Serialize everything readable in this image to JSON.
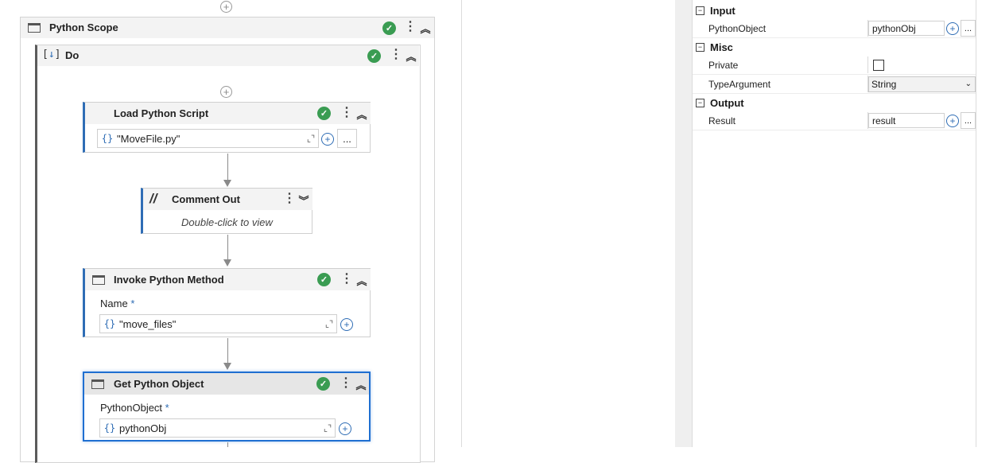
{
  "designer": {
    "python_scope": {
      "title": "Python Scope"
    },
    "do": {
      "title": "Do"
    },
    "load_script": {
      "title": "Load Python Script",
      "code": "\"MoveFile.py\"",
      "more": "..."
    },
    "comment_out": {
      "title": "Comment Out",
      "hint": "Double-click to view"
    },
    "invoke_method": {
      "title": "Invoke Python Method",
      "field_label": "Name",
      "required": "*",
      "code": "\"move_files\""
    },
    "get_object": {
      "title": "Get Python Object",
      "field_label": "PythonObject",
      "required": "*",
      "code": "pythonObj"
    }
  },
  "properties": {
    "categories": [
      {
        "name": "Input",
        "toggle": "⊟",
        "rows": [
          {
            "name": "PythonObject",
            "value": "pythonObj",
            "kind": "text"
          }
        ]
      },
      {
        "name": "Misc",
        "toggle": "⊟",
        "rows": [
          {
            "name": "Private",
            "kind": "checkbox",
            "checked": false
          },
          {
            "name": "TypeArgument",
            "value": "String",
            "kind": "select"
          }
        ]
      },
      {
        "name": "Output",
        "toggle": "⊟",
        "rows": [
          {
            "name": "Result",
            "value": "result",
            "kind": "text"
          }
        ]
      }
    ],
    "more": "..."
  },
  "colors": {
    "accent": "#2f6db5",
    "success": "#3a9c52",
    "selected_border": "#1f6fd1"
  }
}
